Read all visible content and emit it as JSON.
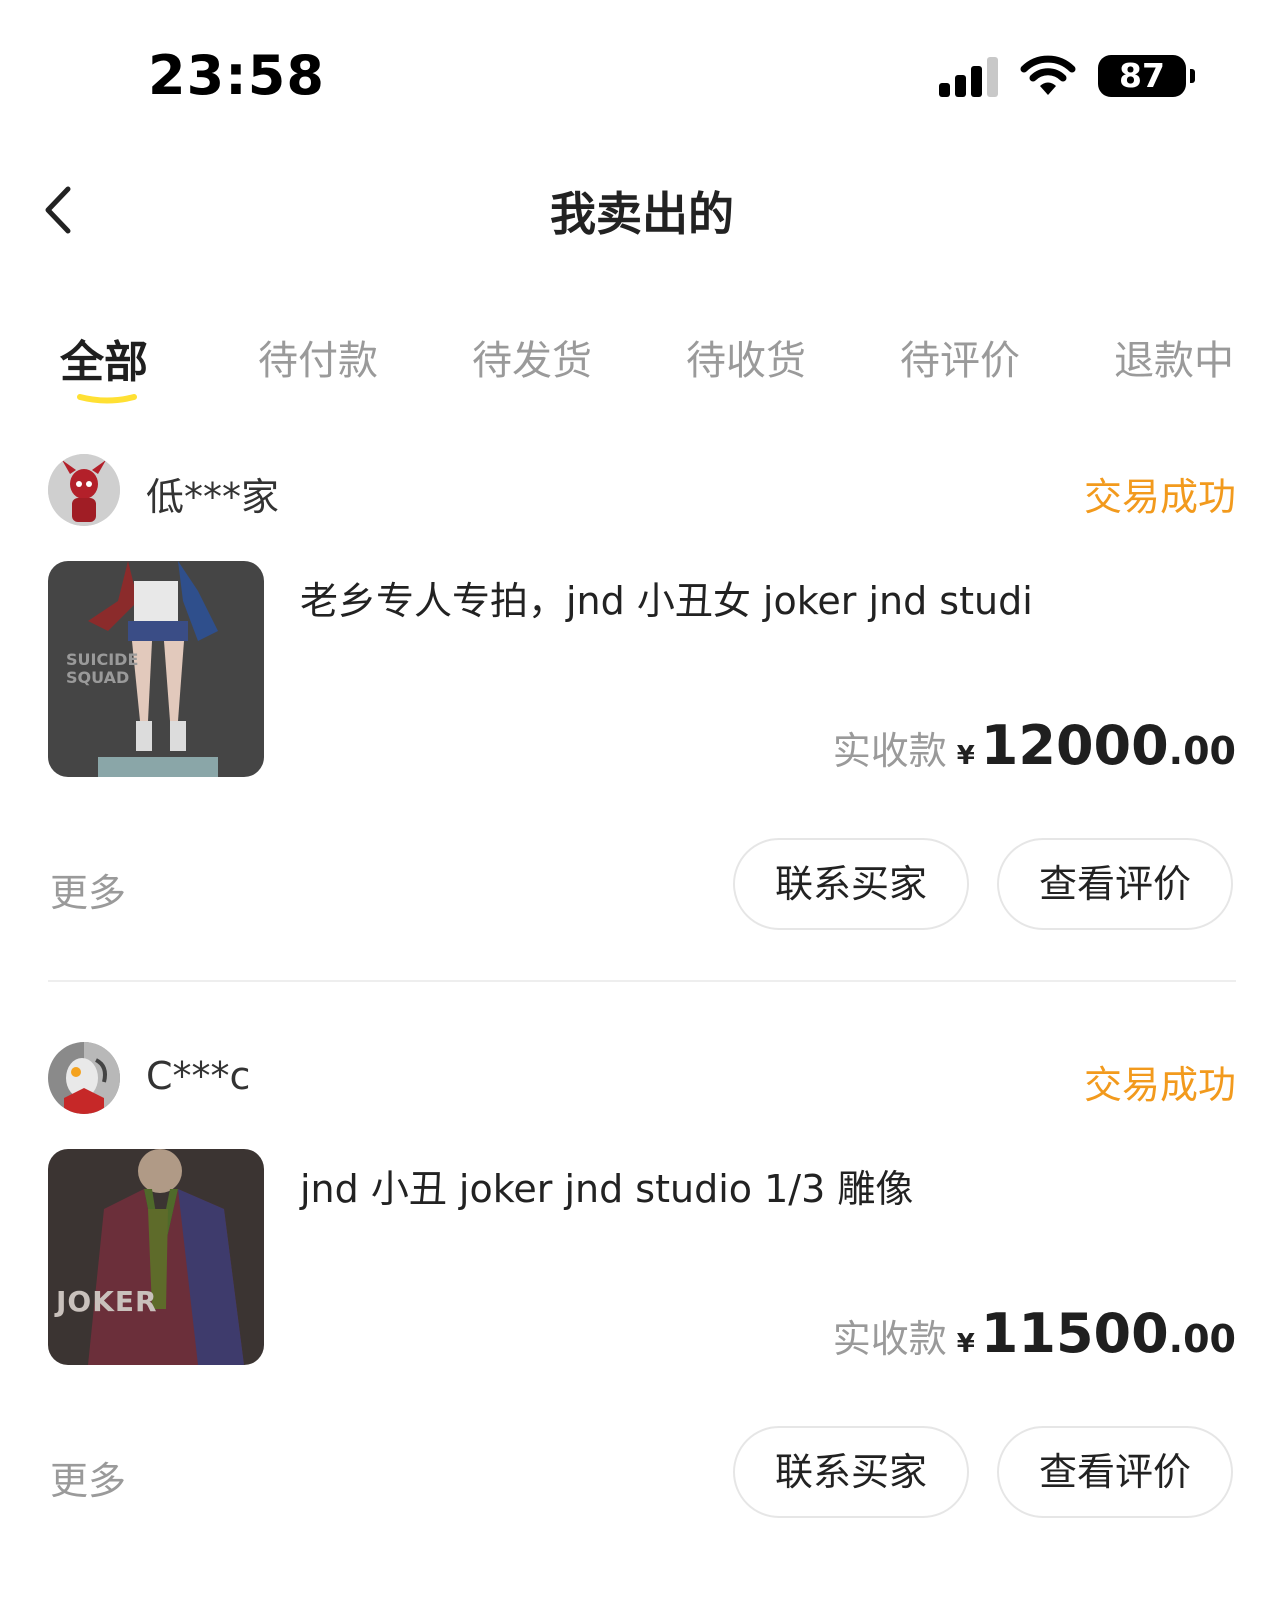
{
  "status_bar": {
    "time": "23:58",
    "battery": "87"
  },
  "header": {
    "title": "我卖出的"
  },
  "tabs": [
    {
      "label": "全部",
      "active": true
    },
    {
      "label": "待付款",
      "active": false
    },
    {
      "label": "待发货",
      "active": false
    },
    {
      "label": "待收货",
      "active": false
    },
    {
      "label": "待评价",
      "active": false
    },
    {
      "label": "退款中",
      "active": false
    }
  ],
  "orders": [
    {
      "buyer": "低***家",
      "status": "交易成功",
      "title": "老乡专人专拍，jnd 小丑女 joker jnd studi",
      "price_label": "实收款",
      "currency": "¥",
      "price_int": "12000",
      "price_dec": ".00",
      "more": "更多",
      "contact_button": "联系买家",
      "review_button": "查看评价",
      "thumb_text": "SUICIDE SQUAD"
    },
    {
      "buyer": "C***c",
      "status": "交易成功",
      "title": "jnd 小丑 joker jnd studio 1/3 雕像",
      "price_label": "实收款",
      "currency": "¥",
      "price_int": "11500",
      "price_dec": ".00",
      "more": "更多",
      "contact_button": "联系买家",
      "review_button": "查看评价",
      "thumb_text": "JOKER"
    }
  ],
  "colors": {
    "accent": "#f29a1d",
    "tab_underline": "#ffe033",
    "muted": "#9a9a9a"
  }
}
